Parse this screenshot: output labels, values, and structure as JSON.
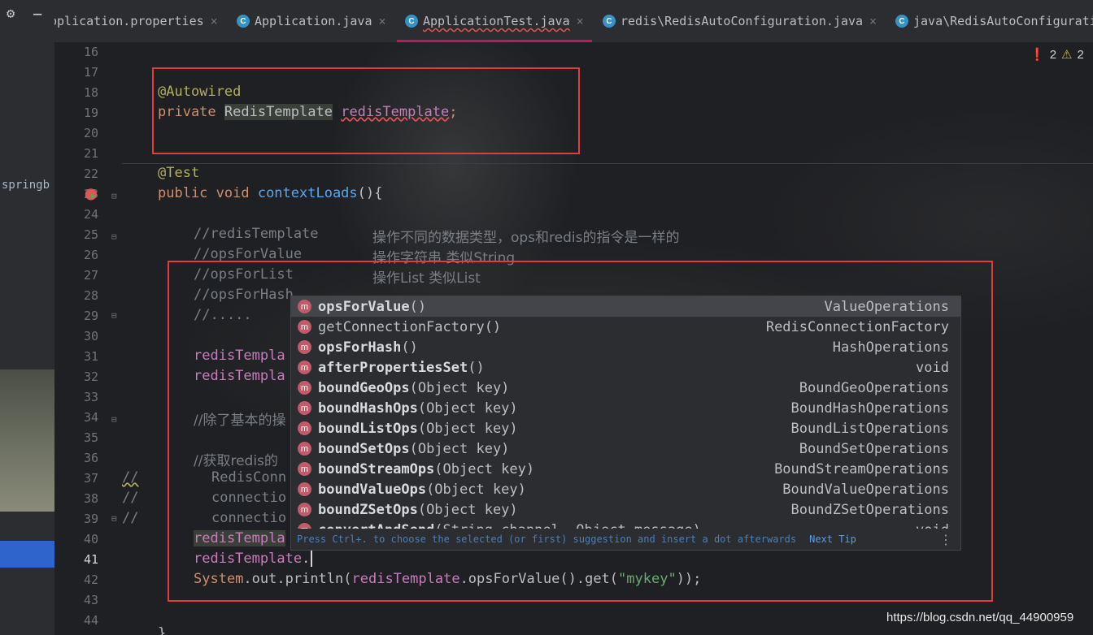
{
  "left_panel": {
    "project_label": "springb"
  },
  "tabs": [
    {
      "label": "pplication.properties",
      "active": false
    },
    {
      "label": "Application.java",
      "active": false
    },
    {
      "label": "ApplicationTest.java",
      "active": true
    },
    {
      "label": "redis\\RedisAutoConfiguration.java",
      "active": false
    },
    {
      "label": "java\\RedisAutoConfigurati",
      "active": false
    }
  ],
  "problems": {
    "errors": "2",
    "warnings": "2"
  },
  "line_numbers": [
    "16",
    "17",
    "18",
    "19",
    "20",
    "21",
    "22",
    "23",
    "24",
    "25",
    "26",
    "27",
    "28",
    "29",
    "30",
    "31",
    "32",
    "33",
    "34",
    "35",
    "36",
    "37",
    "38",
    "39",
    "40",
    "41",
    "42",
    "43",
    "44"
  ],
  "current_line": "41",
  "code": {
    "l18": "@Autowired",
    "l19_kw": "private ",
    "l19_type": "RedisTemplate",
    "l19_field": "redisTemplate",
    "l19_end": ";",
    "l22": "@Test",
    "l23_kw": "public void ",
    "l23_fn": "contextLoads",
    "l23_end": "(){",
    "l25_a": "//redisTemplate",
    "l25_b": "操作不同的数据类型，ops和redis的指令是一样的",
    "l26_a": "//opsForValue",
    "l26_b": "操作字符串 类似String",
    "l27_a": "//opsForList",
    "l27_b": "操作List 类似List",
    "l28": "//opsForHash",
    "l29": "//.....",
    "l31": "redisTempla",
    "l32": "redisTempla",
    "l34": "//除了基本的操",
    "l36": "//获取redis的",
    "l37_mark": "//",
    "l37": "RedisConn",
    "l38_mark": "//",
    "l38": "connectio",
    "l39_mark": "//",
    "l39": "connectio",
    "l40": "redisTempla",
    "l41_field": "redisTemplate",
    "l41_dot": ".",
    "l42_sys": "System",
    "l42_out": ".out.",
    "l42_println": "println(",
    "l42_field": "redisTemplate",
    "l42_call": ".opsForValue().get(",
    "l42_str": "\"mykey\"",
    "l42_end": "));",
    "l45": "}"
  },
  "completion": {
    "items": [
      {
        "bold": "opsForValue",
        "rest": "()",
        "type": "ValueOperations",
        "icon": "m"
      },
      {
        "bold": "",
        "rest": "getConnectionFactory()",
        "type": "RedisConnectionFactory",
        "icon": "m"
      },
      {
        "bold": "opsForHash",
        "rest": "()",
        "type": "HashOperations",
        "icon": "m"
      },
      {
        "bold": "afterPropertiesSet",
        "rest": "()",
        "type": "void",
        "icon": "m"
      },
      {
        "bold": "boundGeoOps",
        "rest": "(Object key)",
        "type": "BoundGeoOperations",
        "icon": "m"
      },
      {
        "bold": "boundHashOps",
        "rest": "(Object key)",
        "type": "BoundHashOperations",
        "icon": "m"
      },
      {
        "bold": "boundListOps",
        "rest": "(Object key)",
        "type": "BoundListOperations",
        "icon": "m"
      },
      {
        "bold": "boundSetOps",
        "rest": "(Object key)",
        "type": "BoundSetOperations",
        "icon": "m"
      },
      {
        "bold": "boundStreamOps",
        "rest": "(Object key)",
        "type": "BoundStreamOperations",
        "icon": "m"
      },
      {
        "bold": "boundValueOps",
        "rest": "(Object key)",
        "type": "BoundValueOperations",
        "icon": "m"
      },
      {
        "bold": "boundZSetOps",
        "rest": "(Object key)",
        "type": "BoundZSetOperations",
        "icon": "m"
      },
      {
        "bold": "convertAndSend",
        "rest": "(String channel, Object message)",
        "type": "void",
        "icon": "m"
      }
    ],
    "hint": "Press Ctrl+. to choose the selected (or first) suggestion and insert a dot afterwards",
    "next_tip": "Next Tip"
  },
  "watermark": "https://blog.csdn.net/qq_44900959"
}
